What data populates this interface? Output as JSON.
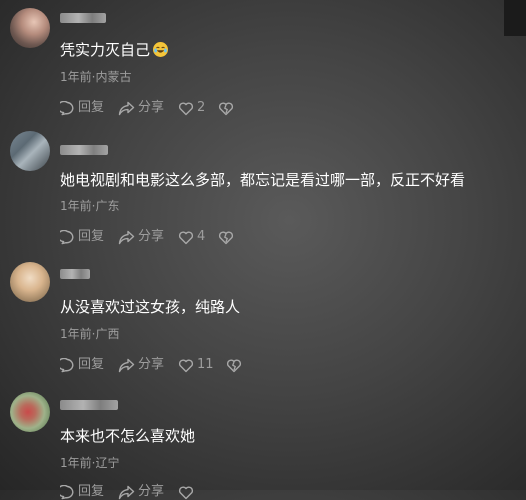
{
  "comments": [
    {
      "text": "凭实力灭自己",
      "emoji": "laughing-tears-emoji",
      "meta": "1年前·内蒙古",
      "reply": "回复",
      "share": "分享",
      "likes": "2"
    },
    {
      "text": "她电视剧和电影这么多部，都忘记是看过哪一部，反正不好看",
      "meta": "1年前·广东",
      "reply": "回复",
      "share": "分享",
      "likes": "4"
    },
    {
      "text": "从没喜欢过这女孩，纯路人",
      "meta": "1年前·广西",
      "reply": "回复",
      "share": "分享",
      "likes": "11"
    },
    {
      "text": "本来也不怎么喜欢她",
      "meta": "1年前·辽宁",
      "reply": "回复",
      "share": "分享",
      "likes": ""
    }
  ],
  "icons": {
    "reply": "comment-bubble-icon",
    "share": "share-arrow-icon",
    "like": "heart-icon",
    "dislike": "broken-heart-icon"
  }
}
